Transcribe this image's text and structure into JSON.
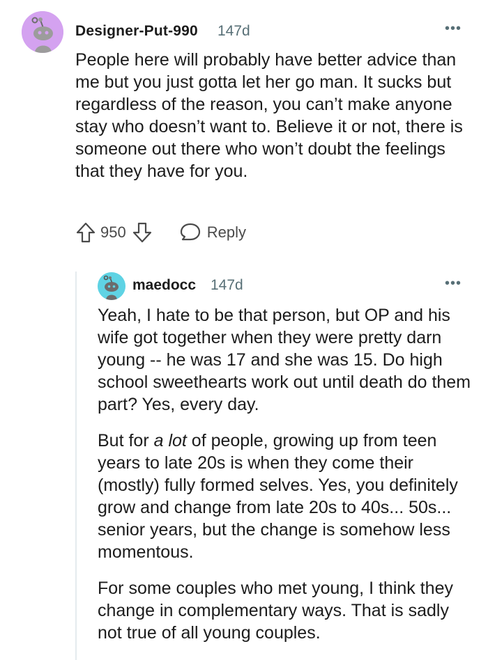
{
  "comments": [
    {
      "username": "Designer-Put-990",
      "age": "147d",
      "avatar_color": "#d4a2f0",
      "more_icon": "ellipsis-icon",
      "body": "People here will probably have better advice than me but you just gotta let her go man. It sucks but regardless of the reason, you can’t make anyone stay who doesn’t want to. Believe it or not, there is someone out there who won’t doubt the feelings that they have for you.",
      "score": "950",
      "reply_label": "Reply"
    },
    {
      "username": "maedocc",
      "age": "147d",
      "avatar_color": "#5fd3e4",
      "more_icon": "ellipsis-icon",
      "paragraphs": {
        "p1": "Yeah, I hate to be that person, but OP and his wife got together when they were pretty darn young -- he was 17 and she was 15. Do high school sweethearts work out until death do them part? Yes, every day.",
        "p2_before": "But for ",
        "p2_emphasis": "a lot",
        "p2_after": " of people, growing up from teen years to late 20s is when they come their (mostly) fully formed selves. Yes, you definitely grow and change from late 20s to 40s... 50s... senior years, but the change is somehow less momentous.",
        "p3": "For some couples who met young, I think they change in complementary ways. That is sadly not true of all young couples."
      }
    }
  ]
}
